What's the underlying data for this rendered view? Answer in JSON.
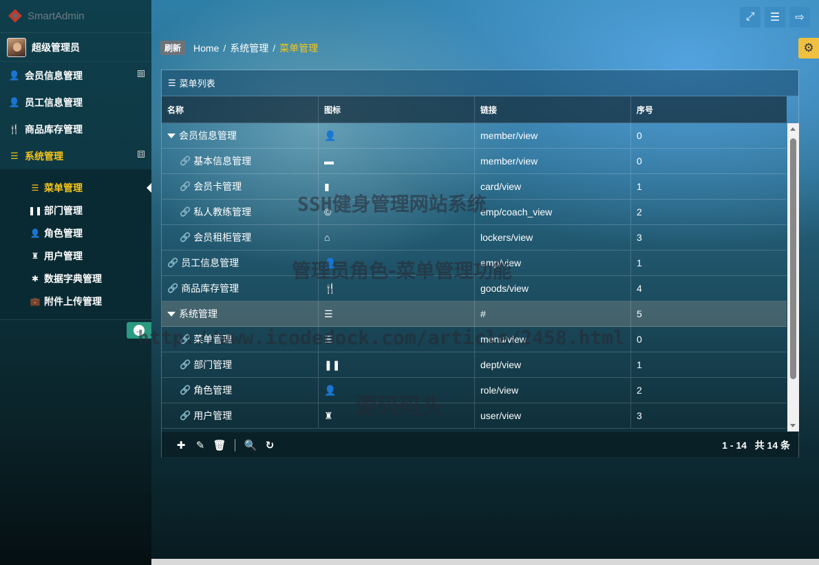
{
  "app": {
    "logo_text": "SmartAdmin"
  },
  "user": {
    "name": "超级管理员"
  },
  "sidebar": {
    "items": [
      {
        "label": "会员信息管理",
        "icon": "user-icon",
        "expand": "⊞"
      },
      {
        "label": "员工信息管理",
        "icon": "user-icon"
      },
      {
        "label": "商品库存管理",
        "icon": "cutlery-icon"
      },
      {
        "label": "系统管理",
        "icon": "list-icon",
        "expand": "⊟"
      }
    ],
    "sub_items": [
      {
        "label": "菜单管理",
        "icon": "list-icon"
      },
      {
        "label": "部门管理",
        "icon": "pause-icon"
      },
      {
        "label": "角色管理",
        "icon": "user-icon"
      },
      {
        "label": "用户管理",
        "icon": "rook-icon"
      },
      {
        "label": "数据字典管理",
        "icon": "asterisk-icon"
      },
      {
        "label": "附件上传管理",
        "icon": "briefcase-icon"
      }
    ]
  },
  "breadcrumb": {
    "refresh": "刷新",
    "home": "Home",
    "level1": "系统管理",
    "current": "菜单管理"
  },
  "panel": {
    "title": "菜单列表"
  },
  "table": {
    "headers": [
      "名称",
      "图标",
      "链接",
      "序号"
    ],
    "rows": [
      {
        "name": "会员信息管理",
        "icon": "user-icon",
        "link": "member/view",
        "order": "0"
      },
      {
        "name": "基本信息管理",
        "icon": "folder-icon",
        "link": "member/view",
        "order": "0"
      },
      {
        "name": "会员卡管理",
        "icon": "book-icon",
        "link": "card/view",
        "order": "1"
      },
      {
        "name": "私人教练管理",
        "icon": "copyright-icon",
        "link": "emp/coach_view",
        "order": "2"
      },
      {
        "name": "会员租柜管理",
        "icon": "home-icon",
        "link": "lockers/view",
        "order": "3"
      },
      {
        "name": "员工信息管理",
        "icon": "user-icon",
        "link": "emp/view",
        "order": "1"
      },
      {
        "name": "商品库存管理",
        "icon": "cutlery-icon",
        "link": "goods/view",
        "order": "4"
      },
      {
        "name": "系统管理",
        "icon": "list-icon",
        "link": "#",
        "order": "5"
      },
      {
        "name": "菜单管理",
        "icon": "list-icon",
        "link": "menu/view",
        "order": "0"
      },
      {
        "name": "部门管理",
        "icon": "pause-icon",
        "link": "dept/view",
        "order": "1"
      },
      {
        "name": "角色管理",
        "icon": "user-icon",
        "link": "role/view",
        "order": "2"
      },
      {
        "name": "用户管理",
        "icon": "rook-icon",
        "link": "user/view",
        "order": "3"
      }
    ]
  },
  "pager": {
    "text": "1 - 14   共 14 条"
  },
  "watermarks": {
    "w1": "SSH健身管理网站系统",
    "w2": "管理员角色-菜单管理功能",
    "w3": "http://www.icodedock.com/article/2458.html",
    "w4": "源码码头"
  }
}
